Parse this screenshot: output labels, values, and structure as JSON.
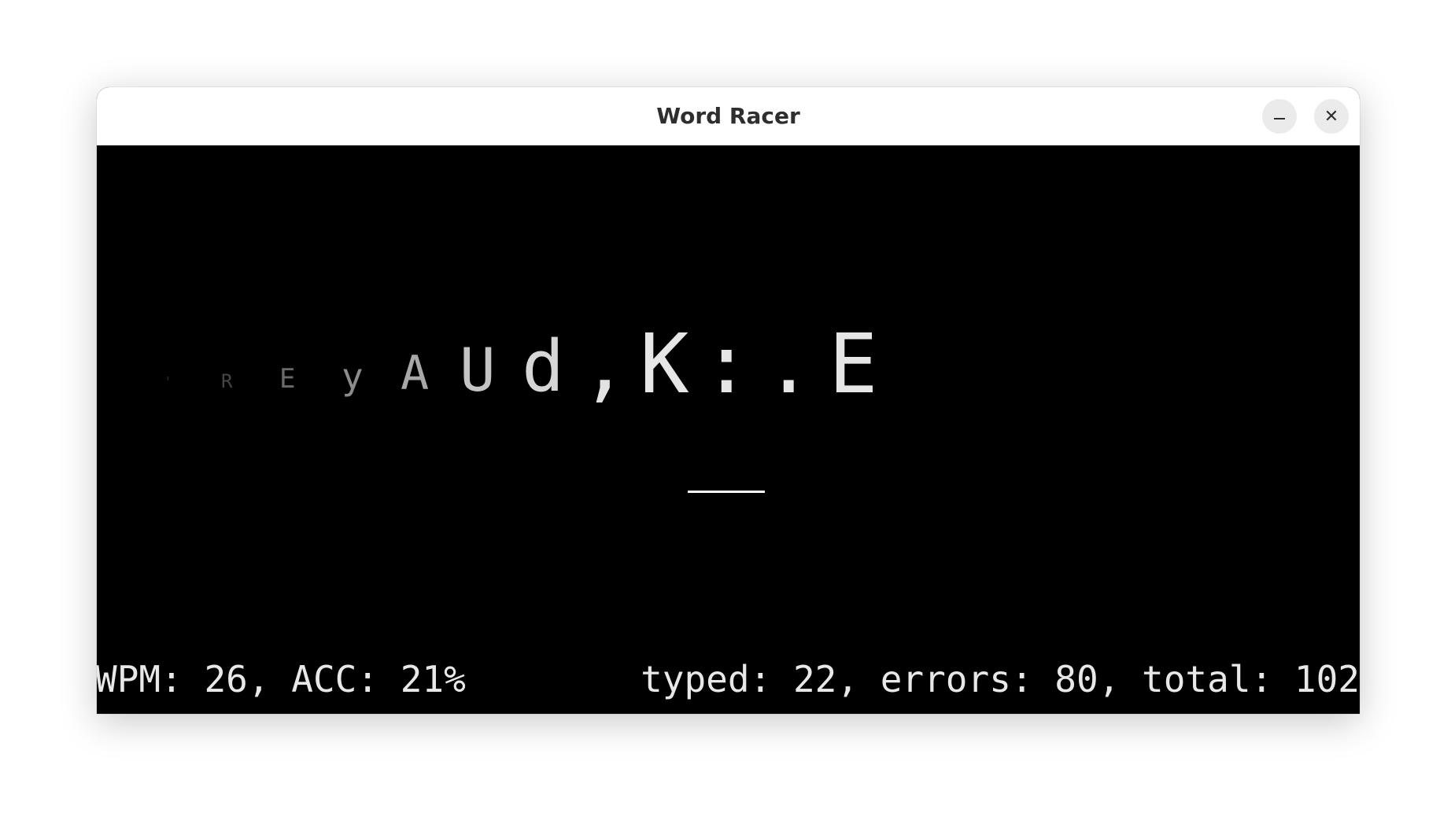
{
  "window": {
    "title": "Word Racer",
    "minimize_icon": "minimize-icon",
    "close_icon": "close-icon",
    "close_glyph": "✕"
  },
  "game": {
    "stream": [
      {
        "ch": "'",
        "size": 18,
        "color": "#2a2a2a"
      },
      {
        "ch": "R",
        "size": 24,
        "color": "#454545"
      },
      {
        "ch": "E",
        "size": 34,
        "color": "#6a6a6a"
      },
      {
        "ch": "y",
        "size": 46,
        "color": "#8c8c8c"
      },
      {
        "ch": "A",
        "size": 60,
        "color": "#a8a8a8"
      },
      {
        "ch": "U",
        "size": 76,
        "color": "#c4c4c4"
      },
      {
        "ch": "d",
        "size": 90,
        "color": "#d6d6d6"
      },
      {
        "ch": ",",
        "size": 100,
        "color": "#e2e2e2"
      },
      {
        "ch": "K",
        "size": 104,
        "color": "#e6e6e6"
      },
      {
        "ch": ":",
        "size": 104,
        "color": "#e6e6e6"
      },
      {
        "ch": ".",
        "size": 104,
        "color": "#e6e6e6"
      },
      {
        "ch": "E",
        "size": 104,
        "color": "#e6e6e6"
      }
    ],
    "status_left": "WPM: 26, ACC: 21%",
    "status_right": "typed: 22, errors: 80, total: 102"
  }
}
